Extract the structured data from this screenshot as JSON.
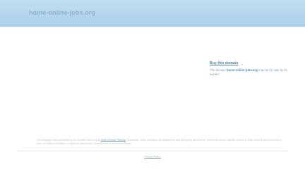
{
  "header": {
    "domain": "home-online-jobs.org"
  },
  "sidebar": {
    "buy_label": "Buy this domain",
    "sale_prefix": "The domain",
    "sale_domain": "home-online-jobs.org",
    "sale_suffix": "may be for sale by its owner!"
  },
  "footer": {
    "disclaimer_part1": "This webpage was generated by the domain owner using",
    "disclaimer_link": "Sedo Domain Parking",
    "disclaimer_part2": ". Disclaimer: Sedo maintains no relationship with third party advertisers. Reference to any specific service or trade mark is not controlled by Sedo nor does it constitute or imply its association, endorsement or recommendation.",
    "privacy_label": "Privacy Policy"
  }
}
